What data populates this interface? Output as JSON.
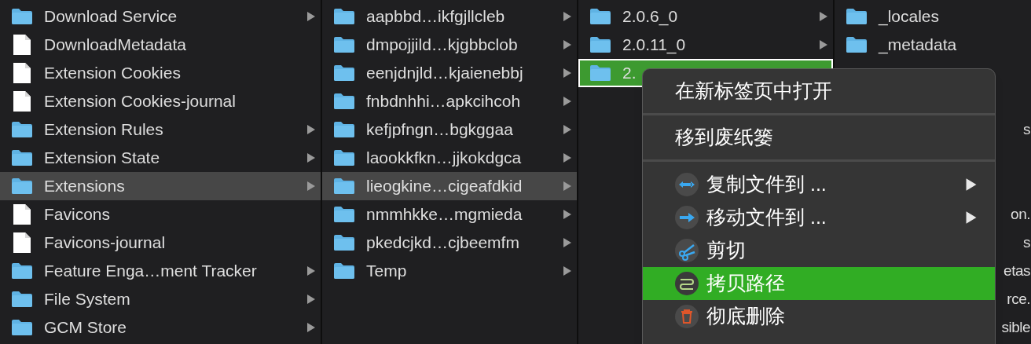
{
  "columns": [
    {
      "items": [
        {
          "kind": "folder",
          "name": "Download Service",
          "selected": false
        },
        {
          "kind": "file",
          "name": "DownloadMetadata",
          "selected": false
        },
        {
          "kind": "file",
          "name": "Extension Cookies",
          "selected": false
        },
        {
          "kind": "file",
          "name": "Extension Cookies-journal",
          "selected": false
        },
        {
          "kind": "folder",
          "name": "Extension Rules",
          "selected": false
        },
        {
          "kind": "folder",
          "name": "Extension State",
          "selected": false
        },
        {
          "kind": "folder",
          "name": "Extensions",
          "selected": true
        },
        {
          "kind": "file",
          "name": "Favicons",
          "selected": false
        },
        {
          "kind": "file",
          "name": "Favicons-journal",
          "selected": false
        },
        {
          "kind": "folder",
          "name": "Feature Enga…ment Tracker",
          "selected": false
        },
        {
          "kind": "folder",
          "name": "File System",
          "selected": false
        },
        {
          "kind": "folder",
          "name": "GCM Store",
          "selected": false
        }
      ],
      "active": false
    },
    {
      "items": [
        {
          "kind": "folder",
          "name": "aapbbd…ikfgjllcleb",
          "selected": false
        },
        {
          "kind": "folder",
          "name": "dmpojjild…kjgbbclob",
          "selected": false
        },
        {
          "kind": "folder",
          "name": "eenjdnjld…kjaienebbj",
          "selected": false
        },
        {
          "kind": "folder",
          "name": "fnbdnhhi…apkcihcoh",
          "selected": false
        },
        {
          "kind": "folder",
          "name": "kefjpfngn…bgkggaa",
          "selected": false
        },
        {
          "kind": "folder",
          "name": "laookkfkn…jjkokdgca",
          "selected": false
        },
        {
          "kind": "folder",
          "name": "lieogkine…cigeafdkid",
          "selected": true
        },
        {
          "kind": "folder",
          "name": "nmmhkke…mgmieda",
          "selected": false
        },
        {
          "kind": "folder",
          "name": "pkedcjkd…cjbeemfm",
          "selected": false
        },
        {
          "kind": "folder",
          "name": "Temp",
          "selected": false
        }
      ],
      "active": false
    },
    {
      "items": [
        {
          "kind": "folder",
          "name": "2.0.6_0",
          "selected": false
        },
        {
          "kind": "folder",
          "name": "2.0.11_0",
          "selected": false
        },
        {
          "kind": "folder",
          "name": "2.",
          "selected": true
        }
      ],
      "active": true
    },
    {
      "items": [
        {
          "kind": "leaf-folder",
          "name": "_locales"
        },
        {
          "kind": "leaf-folder",
          "name": "_metadata"
        },
        {
          "kind": "covered"
        },
        {
          "kind": "covered"
        },
        {
          "kind": "fragment",
          "name": "s"
        },
        {
          "kind": "covered"
        },
        {
          "kind": "covered"
        },
        {
          "kind": "fragment",
          "name": "on."
        },
        {
          "kind": "fragment",
          "name": "s"
        },
        {
          "kind": "fragment",
          "name": "etas"
        },
        {
          "kind": "fragment",
          "name": "rce."
        },
        {
          "kind": "fragment",
          "name": "sible"
        }
      ]
    }
  ],
  "context_menu": {
    "sections": [
      [
        {
          "kind": "plain",
          "label": "在新标签页中打开",
          "selected": false
        }
      ],
      [
        {
          "kind": "plain",
          "label": "移到废纸篓",
          "selected": false
        }
      ],
      [
        {
          "kind": "copy-to",
          "label": "复制文件到 ...",
          "submenu": true,
          "selected": false
        },
        {
          "kind": "move-to",
          "label": "移动文件到 ...",
          "submenu": true,
          "selected": false
        },
        {
          "kind": "cut",
          "label": "剪切",
          "submenu": false,
          "selected": false
        },
        {
          "kind": "copy-path",
          "label": "拷贝路径",
          "submenu": false,
          "selected": true
        },
        {
          "kind": "delete",
          "label": "彻底删除",
          "submenu": false,
          "selected": false
        }
      ]
    ]
  }
}
